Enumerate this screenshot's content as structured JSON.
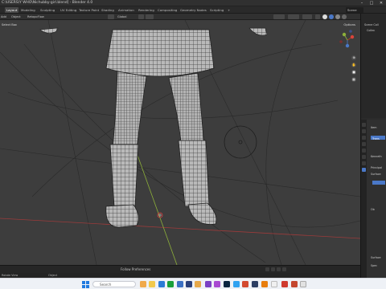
{
  "window": {
    "title": "C:\\USERS\\Y WHO\\Nichubby-girl.blend] - Blender 4.0",
    "minimize": "–",
    "maximize": "□",
    "close": "✕"
  },
  "menu": {
    "tabs": [
      "Layout",
      "Modeling",
      "Sculpting",
      "UV Editing",
      "Texture Paint",
      "Shading",
      "Animation",
      "Rendering",
      "Compositing",
      "Geometry Nodes",
      "Scripting",
      "+"
    ],
    "active": "Layout",
    "scene": "Scene"
  },
  "header": {
    "object_mode": "Object Mode",
    "view": "View",
    "select": "Select",
    "add": "Add",
    "object": "Object",
    "retopoflow": "RetopoFlow",
    "orientation": "Global",
    "overlay_label": "Select Box"
  },
  "viewport": {
    "options": "Options",
    "nav_icons": [
      "zoom-icon",
      "hand-icon",
      "camera-icon",
      "grid-icon"
    ]
  },
  "timeline": {
    "label": "Follow Preferences"
  },
  "statusbar": {
    "left": "Rotate View",
    "right": "Object"
  },
  "outliner": {
    "items": [
      "Scene Coll",
      "Collec"
    ]
  },
  "properties": {
    "labels": [
      "Item",
      "Trans",
      "Kenneth",
      "Principal",
      "Surface",
      "Ob",
      "Surface",
      "Spec"
    ]
  },
  "taskbar": {
    "search": "Search"
  },
  "colors": {
    "accent": "#4a78c8",
    "viewport": "#3d3d3d",
    "wire": "#1a1a1a",
    "mesh": "#b8b8b8",
    "x_axis": "#c0392b",
    "y_axis": "#8db03a"
  }
}
